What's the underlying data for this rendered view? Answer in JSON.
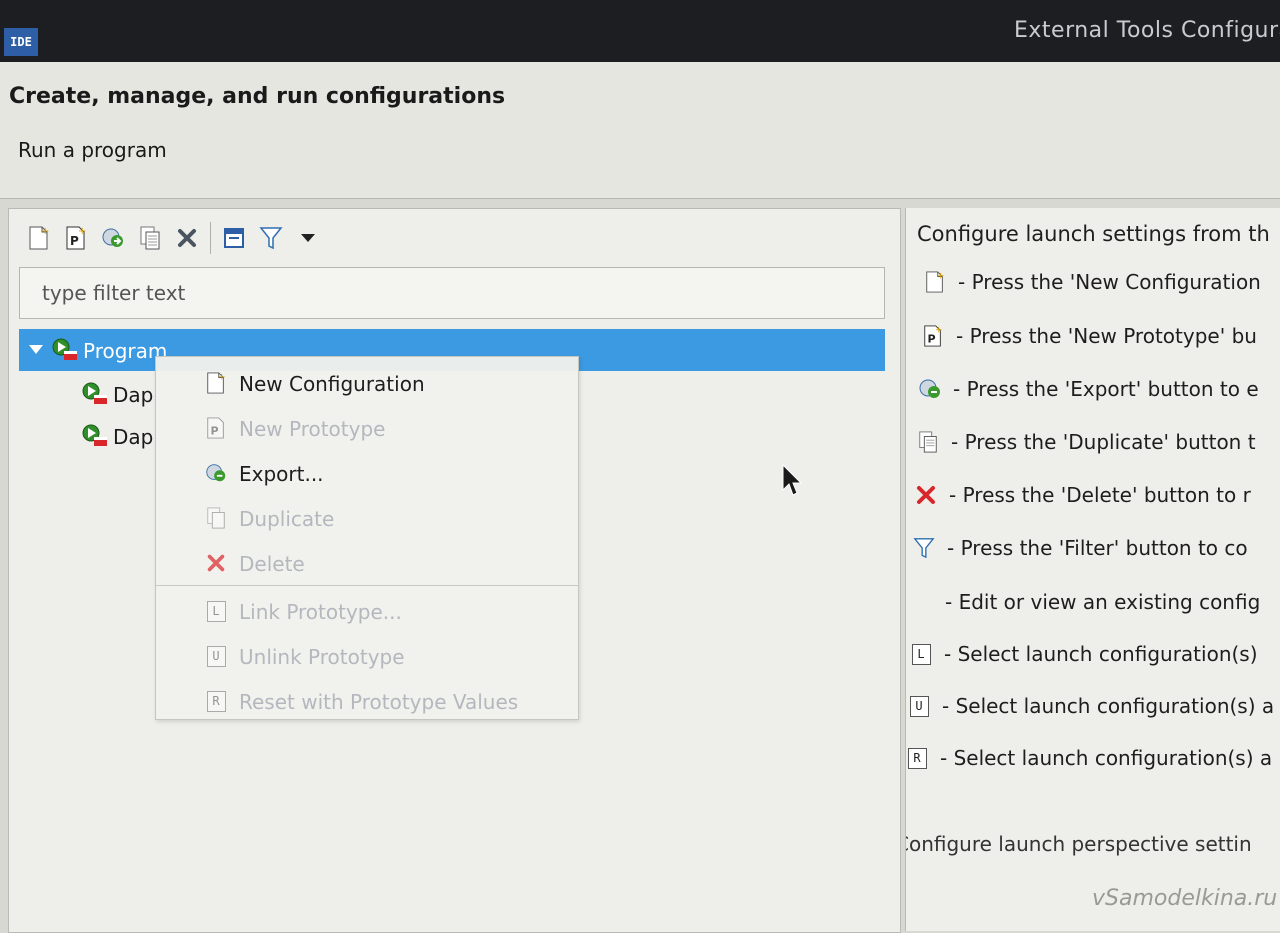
{
  "window": {
    "app_icon_text": "IDE",
    "title": "External Tools Configura"
  },
  "banner": {
    "title": "Create, manage, and run configurations",
    "message": "Run a program"
  },
  "toolbar": {
    "buttons": [
      {
        "icon": "new-configuration-icon"
      },
      {
        "icon": "new-prototype-icon"
      },
      {
        "icon": "export-icon"
      },
      {
        "icon": "duplicate-icon"
      },
      {
        "icon": "delete-icon"
      },
      {
        "icon": "collapse-all-icon"
      },
      {
        "icon": "filter-icon"
      },
      {
        "icon": "view-menu-icon"
      }
    ]
  },
  "filter": {
    "placeholder": "type filter text",
    "value": ""
  },
  "tree": {
    "root": {
      "label": "Program",
      "expanded": true,
      "selected": true
    },
    "children": [
      {
        "label": "Dap"
      },
      {
        "label": "Dap"
      }
    ]
  },
  "context_menu": {
    "items": [
      {
        "label": "New Configuration",
        "enabled": true,
        "icon": "new-configuration-icon"
      },
      {
        "label": "New Prototype",
        "enabled": false,
        "icon": "new-prototype-icon"
      },
      {
        "label": "Export...",
        "enabled": true,
        "icon": "export-icon"
      },
      {
        "label": "Duplicate",
        "enabled": false,
        "icon": "duplicate-icon"
      },
      {
        "label": "Delete",
        "enabled": false,
        "icon": "delete-icon"
      },
      {
        "label": "Link Prototype...",
        "enabled": false,
        "icon": "link-prototype-icon"
      },
      {
        "label": "Unlink Prototype",
        "enabled": false,
        "icon": "unlink-prototype-icon"
      },
      {
        "label": "Reset with Prototype Values",
        "enabled": false,
        "icon": "reset-prototype-icon"
      }
    ]
  },
  "help_panel": {
    "heading": "Configure launch settings from th",
    "lines": [
      {
        "icon": "new-configuration-icon",
        "text": "- Press the 'New Configuration"
      },
      {
        "icon": "new-prototype-icon",
        "text": "- Press the 'New Prototype' bu"
      },
      {
        "icon": "export-icon",
        "text": "- Press the 'Export' button to e"
      },
      {
        "icon": "duplicate-icon",
        "text": "- Press the 'Duplicate' button t"
      },
      {
        "icon": "delete-icon",
        "text": "- Press the 'Delete' button to r"
      },
      {
        "icon": "filter-icon",
        "text": "- Press the 'Filter' button to co"
      },
      {
        "icon": "",
        "text": "- Edit or view an existing config"
      },
      {
        "icon": "link-prototype-icon",
        "text": "- Select launch configuration(s)"
      },
      {
        "icon": "unlink-prototype-icon",
        "text": "- Select launch configuration(s) a"
      },
      {
        "icon": "reset-prototype-icon",
        "text": "- Select launch configuration(s) a"
      }
    ],
    "footer": "Configure launch perspective settin"
  },
  "watermark": "vSamodelkina.ru",
  "colors": {
    "selection": "#3b9ae1",
    "titlebar": "#1c1e22",
    "delete_red": "#d9262b",
    "run_green": "#3a9a2e",
    "disabled_text": "#b4b8be"
  }
}
